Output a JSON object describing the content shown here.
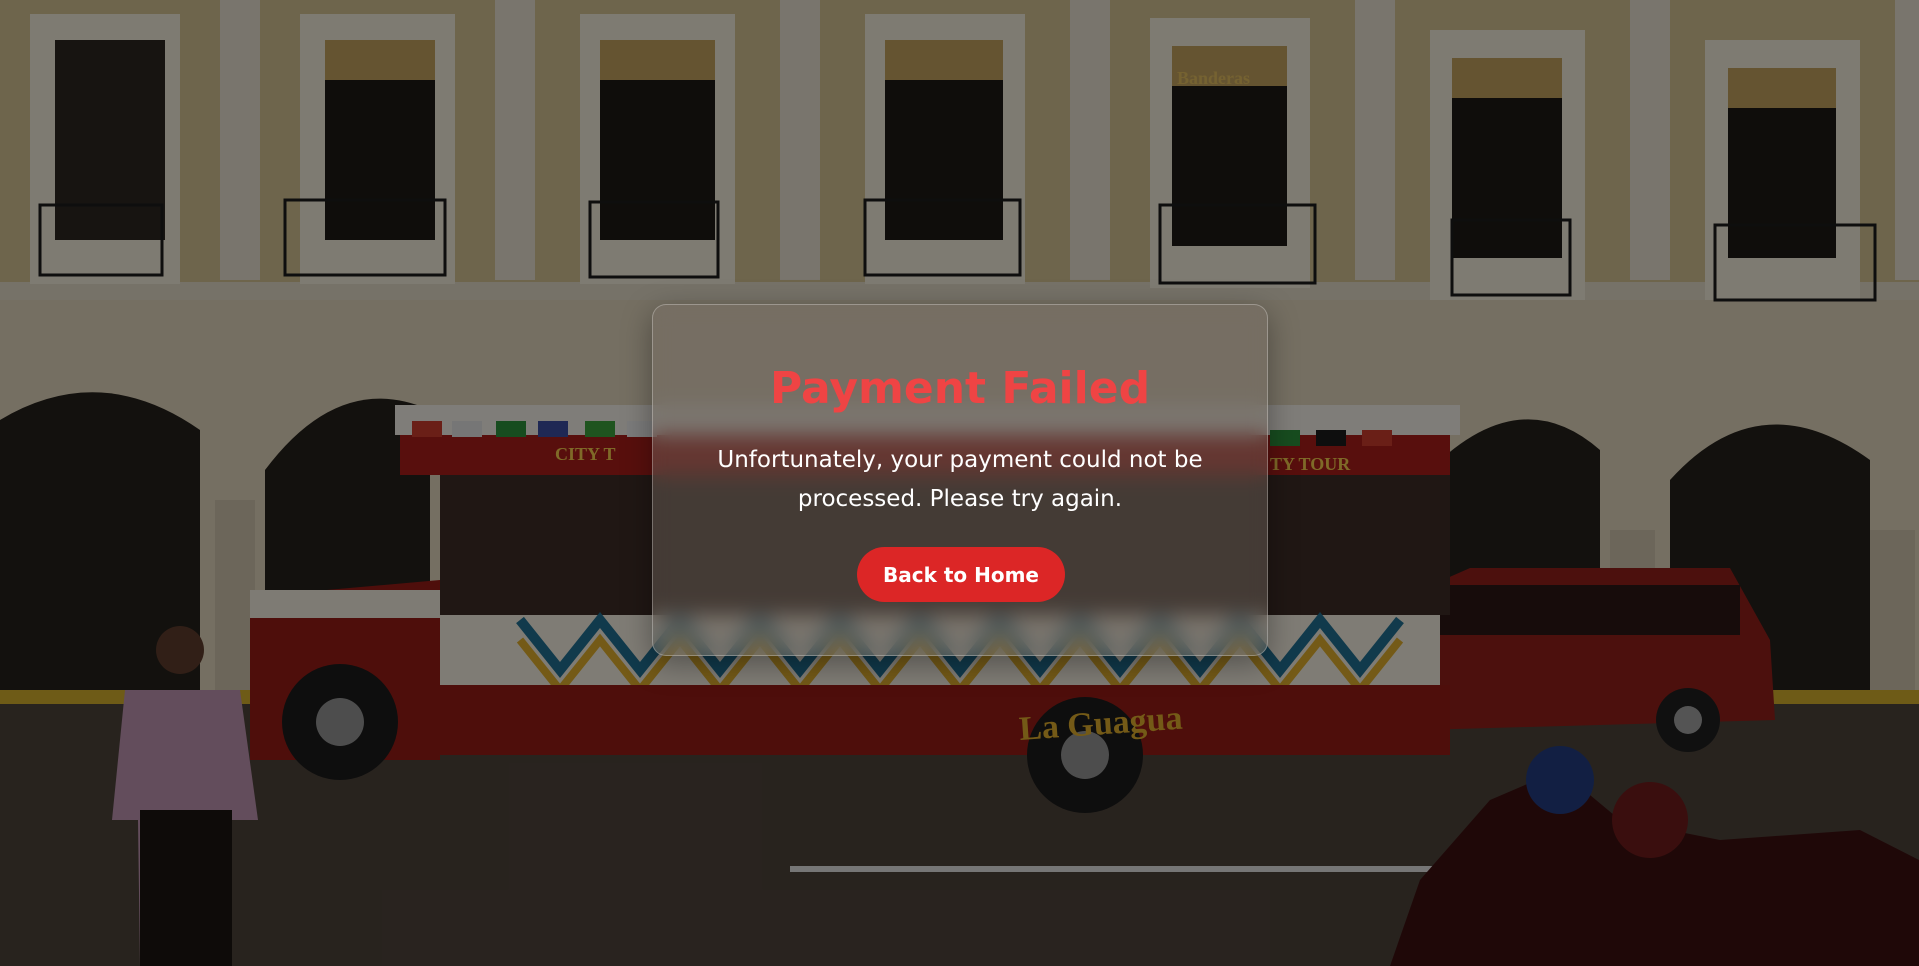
{
  "background": {
    "description_icon": "street-scene-photo",
    "bus_sign_text": "CITY TOUR",
    "bus_name_text": "La Guagua",
    "shop_sign_text": "Banderas"
  },
  "modal": {
    "title": "Payment Failed",
    "message": "Unfortunately, your payment could not be processed. Please try again.",
    "button_label": "Back to Home"
  },
  "colors": {
    "title": "#ef4444",
    "button": "#dc2626",
    "button_text": "#ffffff",
    "message_text": "#ffffff"
  }
}
